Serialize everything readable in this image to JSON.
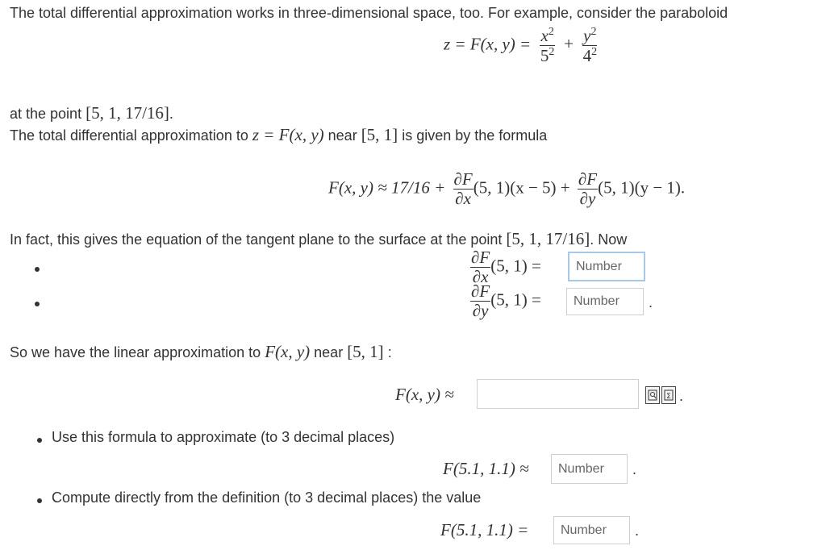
{
  "intro": "The total differential approximation works in three-dimensional space, too. For example, consider the paraboloid",
  "eq_main": {
    "lhs": "z = F(x, y) =",
    "f1_num": "x",
    "f1_num_sup": "2",
    "f1_den": "5",
    "f1_den_sup": "2",
    "plus": "+",
    "f2_num": "y",
    "f2_num_sup": "2",
    "f2_den": "4",
    "f2_den_sup": "2"
  },
  "point_line": {
    "prefix": "at the point ",
    "point": "[5, 1, 17/16]",
    "suffix": "."
  },
  "formula_line": {
    "prefix": "The total differential approximation to ",
    "math": "z = F(x, y)",
    "mid": " near ",
    "point": "[5, 1]",
    "suffix": " is given by the formula"
  },
  "eq_tangent": {
    "lhs": "F(x, y) ≈ 17/16 +",
    "d_num": "∂F",
    "dx_den": "∂x",
    "dy_den": "∂y",
    "term1": "(5, 1)(x − 5) +",
    "term2": "(5, 1)(y − 1)."
  },
  "infact_line": {
    "prefix": "In fact, this gives the equation of the tangent plane to the surface at the point ",
    "point": "[5, 1, 17/16]",
    "suffix": ". Now"
  },
  "partials": {
    "arg": "(5, 1) =",
    "input1_placeholder": "Number",
    "input2_placeholder": "Number",
    "trail": "."
  },
  "linear_line": {
    "prefix": "So we have the linear approximation to ",
    "math": "F(x, y)",
    "mid": " near ",
    "point": "[5, 1]",
    "suffix": " :"
  },
  "approx_row": {
    "lhs": "F(x, y) ≈",
    "trail": "."
  },
  "bullet1": "Use this formula to approximate (to 3 decimal places)",
  "approx_val": {
    "lhs": "F(5.1, 1.1) ≈",
    "placeholder": "Number",
    "trail": "."
  },
  "bullet2": "Compute directly from the definition (to 3 decimal places) the value",
  "exact_val": {
    "lhs": "F(5.1, 1.1) =",
    "placeholder": "Number",
    "trail": "."
  },
  "icons": {
    "preview": "preview-icon",
    "equation": "equation-editor-icon"
  }
}
